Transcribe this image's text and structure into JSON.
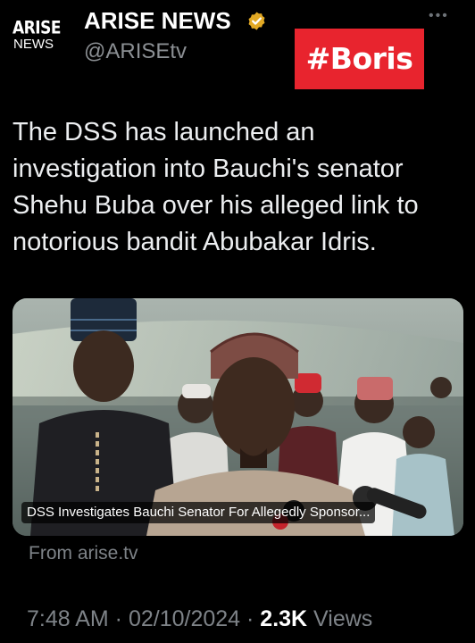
{
  "header": {
    "avatar": {
      "line1": "ARISE",
      "line2": "NEWS"
    },
    "display_name": "ARISE NEWS",
    "verified_icon": "verified-badge-icon",
    "verified_color": "#e2a924",
    "handle": "@ARISEtv",
    "more_icon": "more-dots-icon",
    "hashtag": "#Boris",
    "hashtag_color": "#e8242e"
  },
  "tweet": {
    "text": "The DSS has launched an investigation into Bauchi's senator Shehu Buba over his alleged link to notorious bandit Abubakar Idris."
  },
  "card": {
    "caption": "DSS Investigates Bauchi Senator  For Allegedly Sponsor...",
    "source": "From arise.tv"
  },
  "meta": {
    "time": "7:48 AM",
    "sep1": " · ",
    "date": "02/10/2024",
    "sep2": " · ",
    "views_count": "2.3K",
    "views_label": " Views"
  }
}
